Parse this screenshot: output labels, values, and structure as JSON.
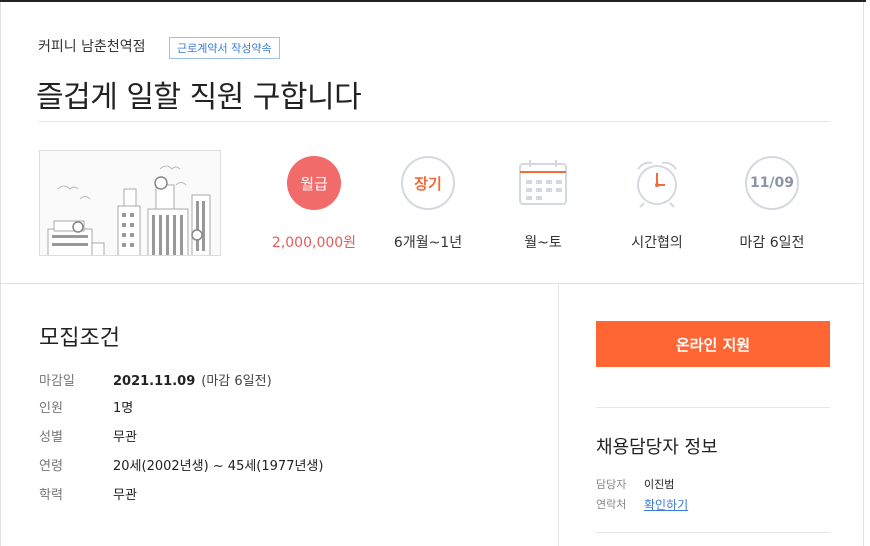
{
  "header": {
    "company": "커피니 남춘천역점",
    "badge": "근로계약서 작성약속",
    "title": "즐겁게 일할 직원 구합니다"
  },
  "conditions": [
    {
      "icon": "salary-badge",
      "icon_text": "월급",
      "label": "2,000,000원"
    },
    {
      "icon": "period-badge",
      "icon_text": "장기",
      "label": "6개월~1년"
    },
    {
      "icon": "calendar-icon",
      "label": "월~토"
    },
    {
      "icon": "alarm-clock-icon",
      "label": "시간협의"
    },
    {
      "icon": "deadline-badge",
      "icon_text": "11/09",
      "label": "마감 6일전"
    }
  ],
  "requirements": {
    "title": "모집조건",
    "rows": [
      {
        "key": "마감일",
        "value": "2021.11.09",
        "sub": "(마감 6일전)"
      },
      {
        "key": "인원",
        "value": "1명"
      },
      {
        "key": "성별",
        "value": "무관"
      },
      {
        "key": "연령",
        "value": "20세(2002년생) ~ 45세(1977년생)"
      },
      {
        "key": "학력",
        "value": "무관"
      }
    ]
  },
  "apply": {
    "label": "온라인 지원"
  },
  "manager": {
    "title": "채용담당자 정보",
    "rows": [
      {
        "key": "담당자",
        "value": "이진범"
      },
      {
        "key": "연락처",
        "link": "확인하기"
      }
    ]
  },
  "colors": {
    "accent": "#ff6633",
    "salary": "#f26b6b",
    "badge_blue": "#3a7bd5"
  }
}
